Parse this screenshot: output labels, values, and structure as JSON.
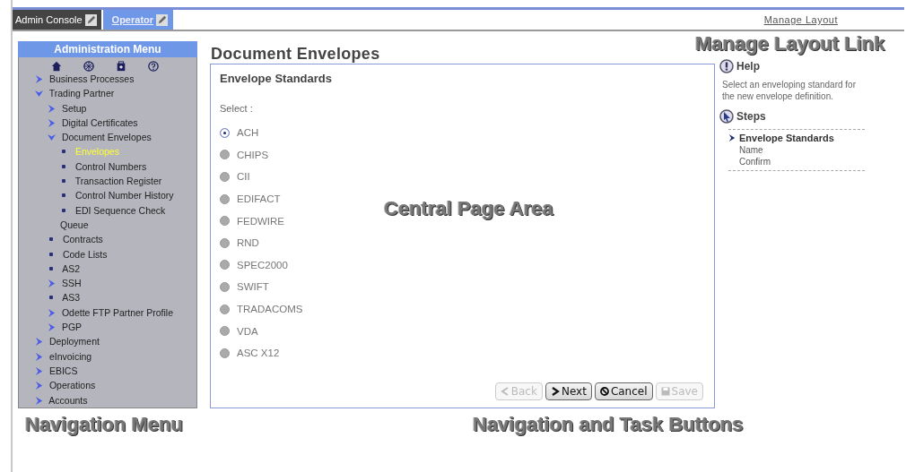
{
  "tabs": [
    {
      "label": "Admin Console",
      "selected": false
    },
    {
      "label": "Operator",
      "selected": true
    }
  ],
  "manage_layout_link": "Manage Layout",
  "menu": {
    "title": "Administration Menu",
    "items": [
      {
        "label": "Business Processes",
        "kind": "folder",
        "expanded": false,
        "selected": false
      },
      {
        "label": "Trading Partner",
        "kind": "folder",
        "expanded": true,
        "selected": false,
        "children": [
          {
            "label": "Setup",
            "kind": "folder",
            "expanded": false,
            "selected": false
          },
          {
            "label": "Digital Certificates",
            "kind": "folder",
            "expanded": false,
            "selected": false
          },
          {
            "label": "Document Envelopes",
            "kind": "folder",
            "expanded": true,
            "selected": false,
            "children": [
              {
                "label": "Envelopes",
                "kind": "leaf",
                "selected": true
              },
              {
                "label": "Control Numbers",
                "kind": "leaf",
                "selected": false
              },
              {
                "label": "Transaction Register",
                "kind": "leaf",
                "selected": false
              },
              {
                "label": "Control Number History",
                "kind": "leaf",
                "selected": false
              },
              {
                "label": "EDI Sequence Check Queue",
                "kind": "leaf",
                "selected": false
              }
            ]
          },
          {
            "label": "Contracts",
            "kind": "leaf",
            "selected": false
          },
          {
            "label": "Code Lists",
            "kind": "leaf",
            "selected": false
          },
          {
            "label": "AS2",
            "kind": "leaf",
            "selected": false
          },
          {
            "label": "SSH",
            "kind": "folder",
            "expanded": false,
            "selected": false
          },
          {
            "label": "AS3",
            "kind": "leaf",
            "selected": false
          },
          {
            "label": "Odette FTP Partner Profile",
            "kind": "folder",
            "expanded": false,
            "selected": false
          },
          {
            "label": "PGP",
            "kind": "folder",
            "expanded": false,
            "selected": false
          }
        ]
      },
      {
        "label": "Deployment",
        "kind": "folder",
        "expanded": false,
        "selected": false
      },
      {
        "label": "eInvoicing",
        "kind": "folder",
        "expanded": false,
        "selected": false
      },
      {
        "label": "EBICS",
        "kind": "folder",
        "expanded": false,
        "selected": false
      },
      {
        "label": "Operations",
        "kind": "folder",
        "expanded": false,
        "selected": false
      },
      {
        "label": "Accounts",
        "kind": "folder",
        "expanded": false,
        "selected": false
      }
    ]
  },
  "page": {
    "title": "Document Envelopes",
    "section": "Envelope Standards",
    "select_label": "Select :",
    "options": [
      {
        "label": "ACH",
        "selected": true
      },
      {
        "label": "CHIPS",
        "selected": false
      },
      {
        "label": "CII",
        "selected": false
      },
      {
        "label": "EDIFACT",
        "selected": false
      },
      {
        "label": "FEDWIRE",
        "selected": false
      },
      {
        "label": "RND",
        "selected": false
      },
      {
        "label": "SPEC2000",
        "selected": false
      },
      {
        "label": "SWIFT",
        "selected": false
      },
      {
        "label": "TRADACOMS",
        "selected": false
      },
      {
        "label": "VDA",
        "selected": false
      },
      {
        "label": "ASC X12",
        "selected": false
      }
    ],
    "buttons": [
      {
        "label": "Back",
        "kind": "back",
        "disabled": true
      },
      {
        "label": "Next",
        "kind": "next",
        "disabled": false
      },
      {
        "label": "Cancel",
        "kind": "cancel",
        "disabled": false
      },
      {
        "label": "Save",
        "kind": "save",
        "disabled": true
      }
    ]
  },
  "help": {
    "title": "Help",
    "text": "Select an enveloping standard for the new envelope definition.",
    "steps_title": "Steps",
    "steps": [
      {
        "label": "Envelope Standards",
        "selected": true
      },
      {
        "label": "Name",
        "selected": false
      },
      {
        "label": "Confirm",
        "selected": false
      }
    ]
  },
  "annotations": [
    {
      "text": "Manage Layout Link"
    },
    {
      "text": "Central Page Area"
    },
    {
      "text": "Navigation Menu"
    },
    {
      "text": "Navigation and Task Buttons"
    }
  ]
}
